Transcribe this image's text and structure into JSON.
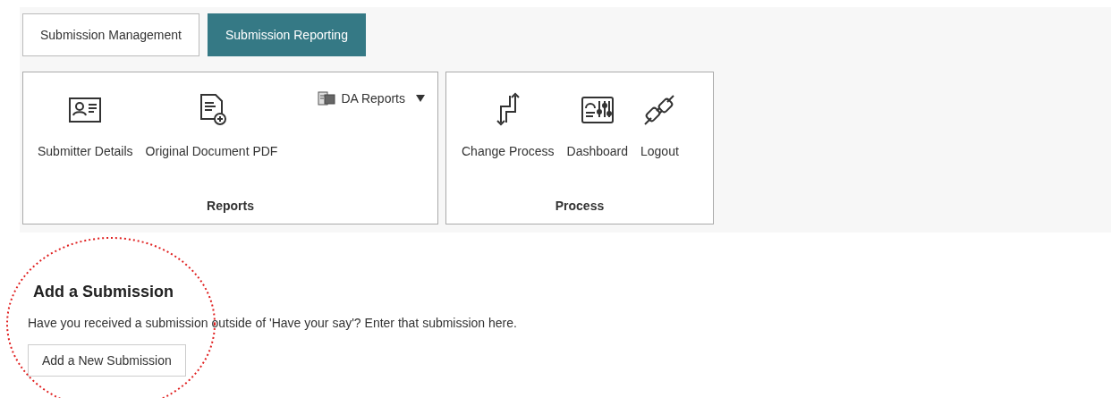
{
  "tabs": [
    {
      "label": "Submission Management",
      "selected": false
    },
    {
      "label": "Submission Reporting",
      "selected": true
    }
  ],
  "ribbon_groups": [
    {
      "title": "Reports",
      "items": [
        {
          "kind": "tool",
          "label": "Submitter Details"
        },
        {
          "kind": "tool",
          "label": "Original Document PDF"
        },
        {
          "kind": "dropdown",
          "label": "DA Reports"
        }
      ]
    },
    {
      "title": "Process",
      "items": [
        {
          "kind": "tool",
          "label": "Change Process"
        },
        {
          "kind": "tool",
          "label": "Dashboard"
        },
        {
          "kind": "tool",
          "label": "Logout"
        }
      ]
    }
  ],
  "add_submission": {
    "title": "Add a Submission",
    "description": "Have you received a submission outside of 'Have your say'? Enter that submission here.",
    "button": "Add a New Submission"
  }
}
